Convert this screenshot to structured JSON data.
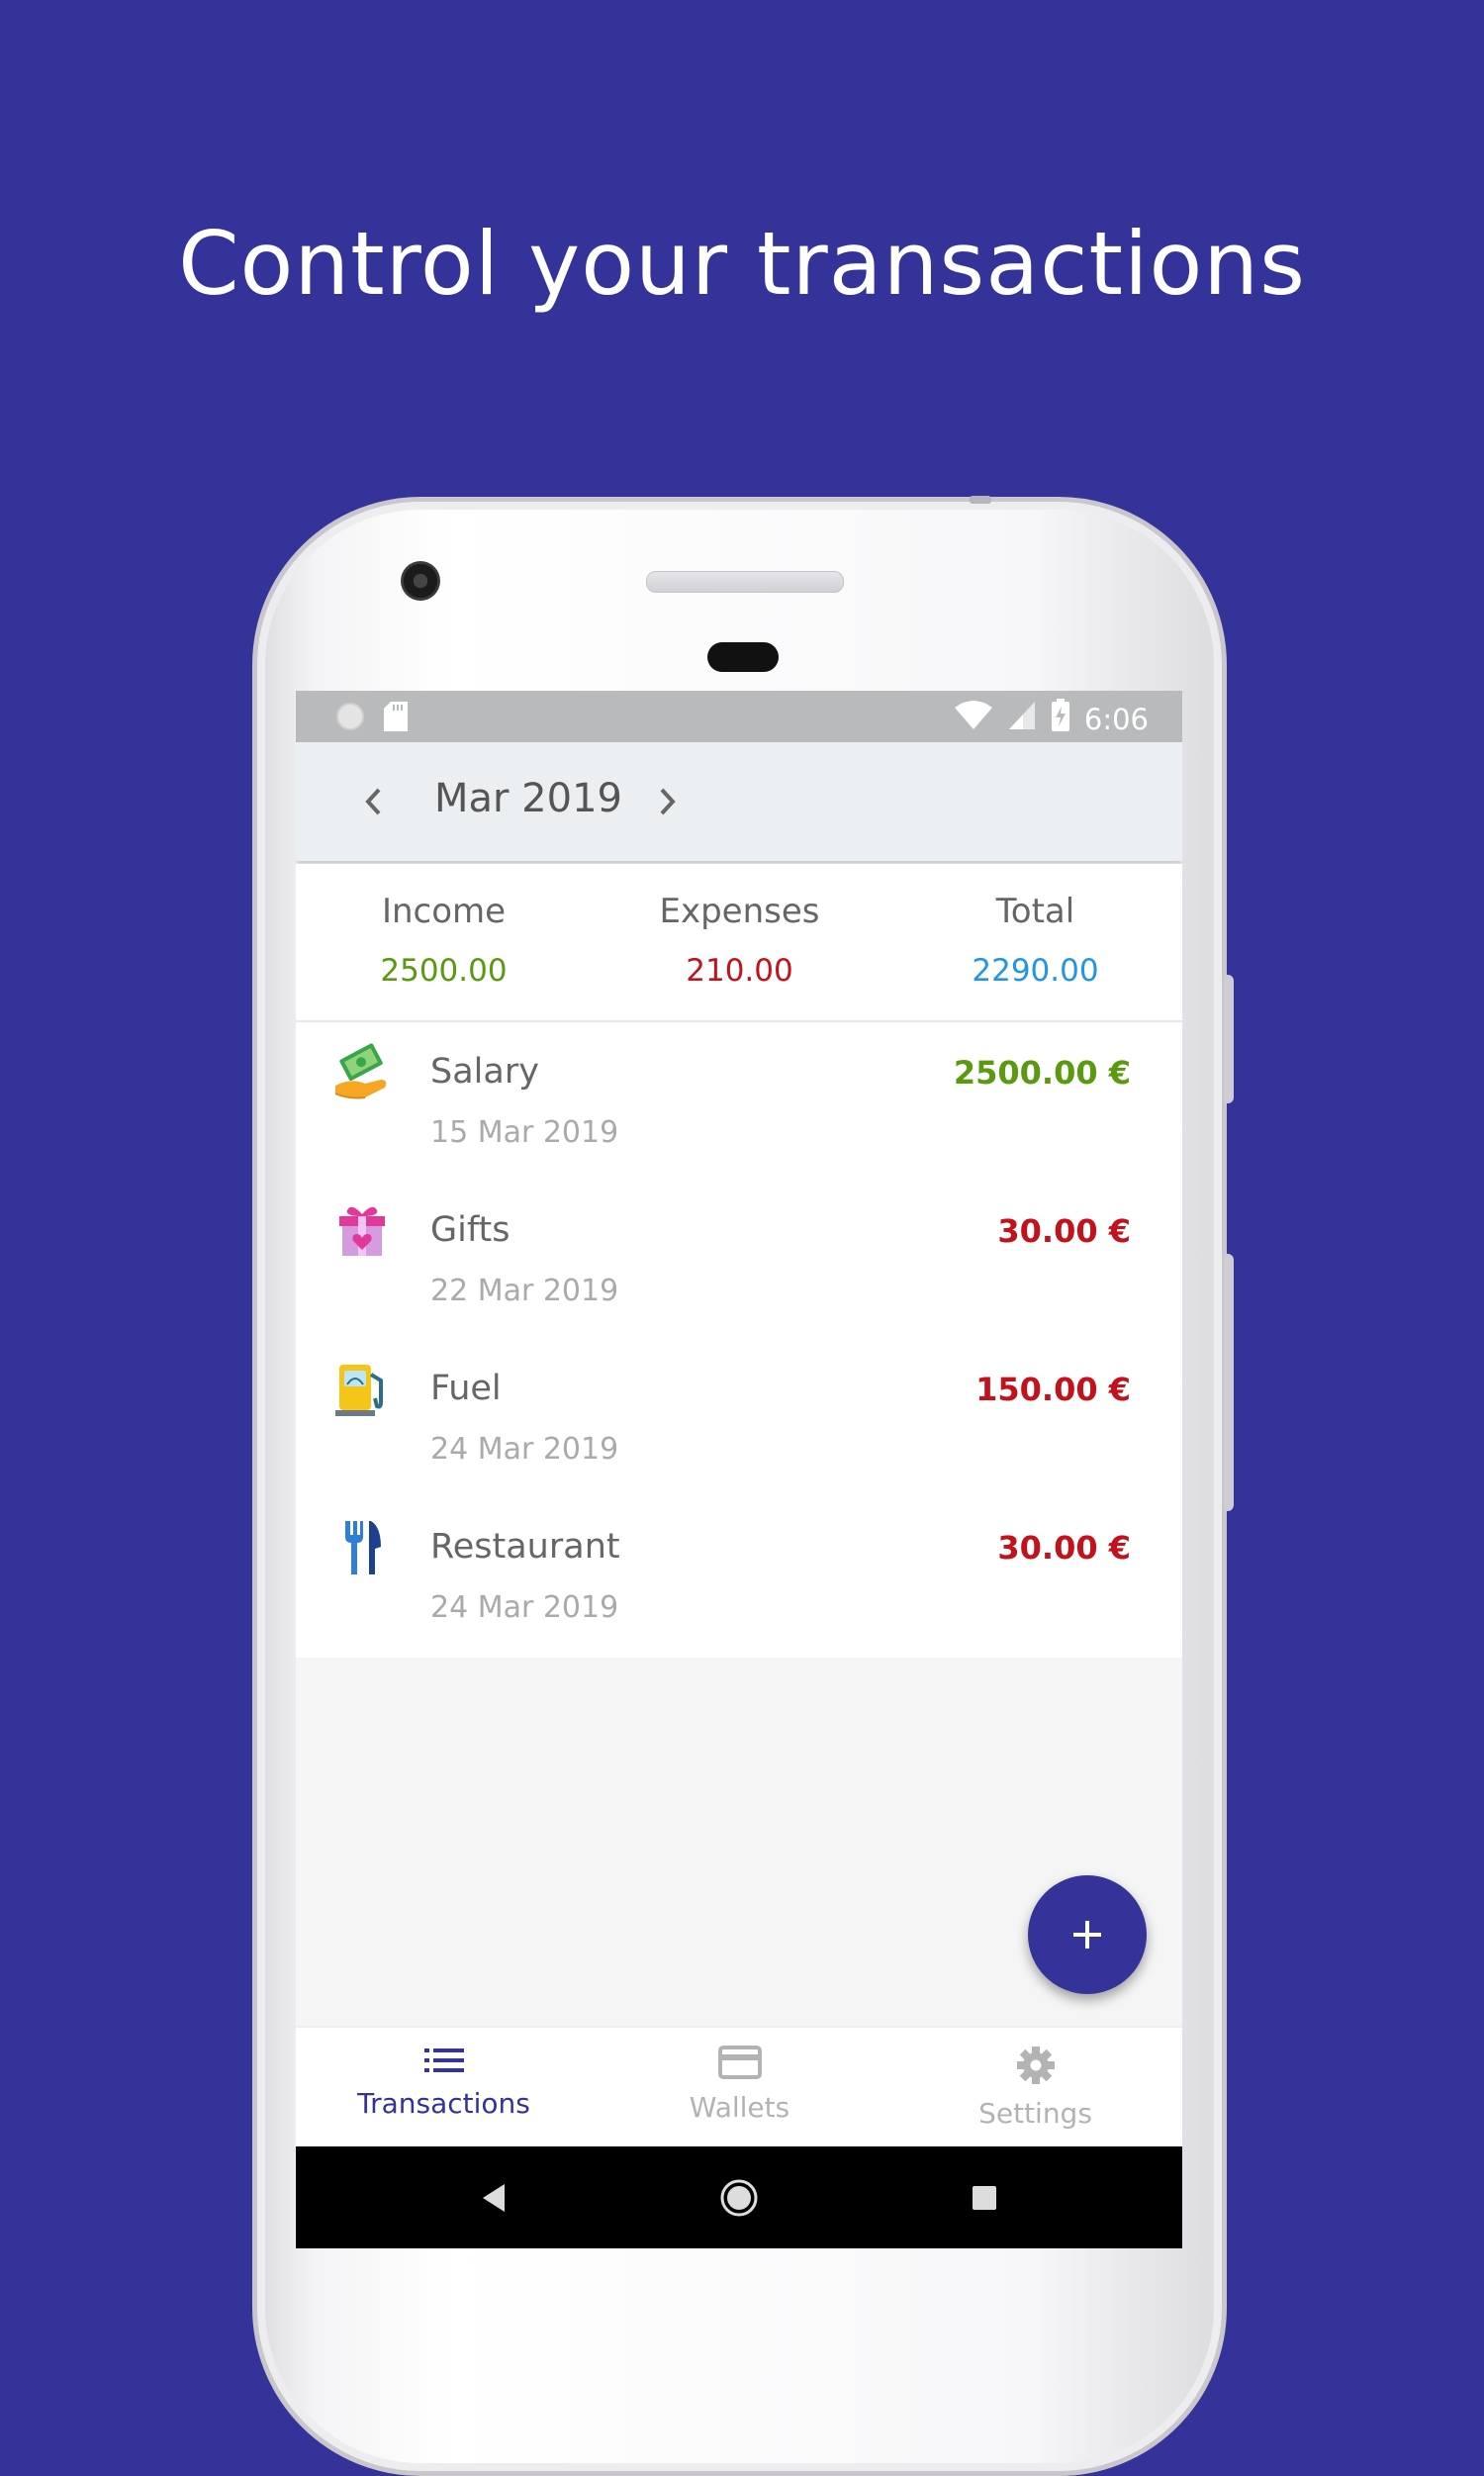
{
  "headline": "Control your transactions",
  "status_bar": {
    "time": "6:06"
  },
  "toolbar": {
    "month": "Mar 2019"
  },
  "summary": {
    "income_label": "Income",
    "income_value": "2500.00",
    "expenses_label": "Expenses",
    "expenses_value": "210.00",
    "total_label": "Total",
    "total_value": "2290.00"
  },
  "transactions": [
    {
      "name": "Salary",
      "date": "15 Mar 2019",
      "amount": "2500.00 €",
      "icon": "salary-icon",
      "color": "#5a9a0f"
    },
    {
      "name": "Gifts",
      "date": "22 Mar 2019",
      "amount": "30.00 €",
      "icon": "gift-icon",
      "color": "#c2121b"
    },
    {
      "name": "Fuel",
      "date": "24 Mar 2019",
      "amount": "150.00 €",
      "icon": "fuel-pump-icon",
      "color": "#c2121b"
    },
    {
      "name": "Restaurant",
      "date": "24 Mar 2019",
      "amount": "30.00 €",
      "icon": "cutlery-icon",
      "color": "#c2121b"
    }
  ],
  "bottom_nav": [
    {
      "label": "Transactions",
      "icon": "list-icon",
      "active": true
    },
    {
      "label": "Wallets",
      "icon": "card-icon",
      "active": false
    },
    {
      "label": "Settings",
      "icon": "gear-icon",
      "active": false
    }
  ],
  "colors": {
    "brand": "#343399",
    "income": "#5a9a0f",
    "expense": "#c2121b",
    "total": "#2196e8",
    "nav_inactive": "#b3b3b3"
  }
}
